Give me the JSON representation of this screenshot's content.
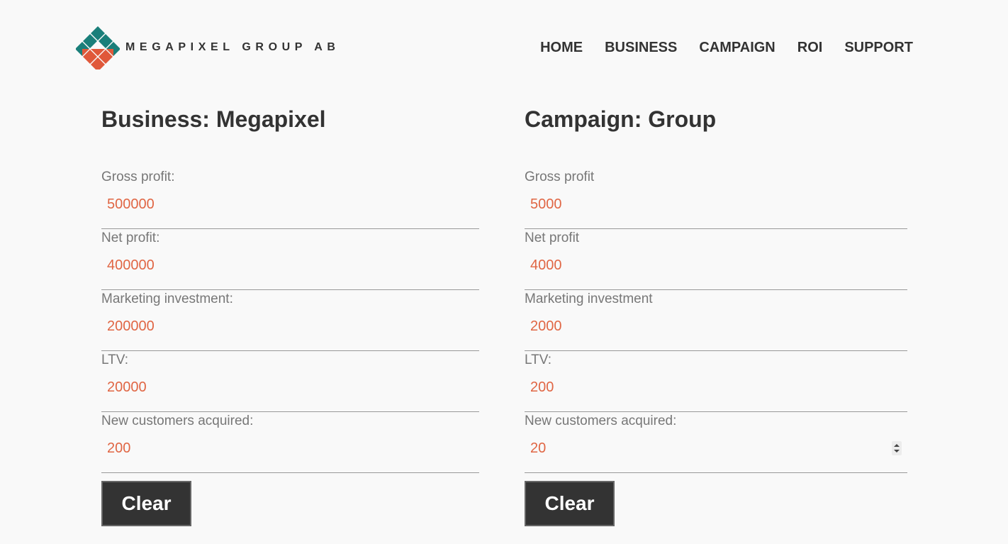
{
  "brand": {
    "name": "MEGAPIXEL GROUP AB",
    "colors": {
      "teal": "#1a7f7a",
      "orange": "#e0583a"
    }
  },
  "nav": {
    "items": [
      {
        "label": "HOME"
      },
      {
        "label": "BUSINESS"
      },
      {
        "label": "CAMPAIGN"
      },
      {
        "label": "ROI"
      },
      {
        "label": "SUPPORT"
      }
    ]
  },
  "business": {
    "title": "Business: Megapixel",
    "fields": [
      {
        "label": "Gross profit:",
        "value": "500000"
      },
      {
        "label": "Net profit:",
        "value": "400000"
      },
      {
        "label": "Marketing investment:",
        "value": "200000"
      },
      {
        "label": "LTV:",
        "value": "20000"
      },
      {
        "label": "New customers acquired:",
        "value": "200"
      }
    ],
    "clear_label": "Clear"
  },
  "campaign": {
    "title": "Campaign: Group",
    "fields": [
      {
        "label": "Gross profit",
        "value": "5000"
      },
      {
        "label": "Net profit",
        "value": "4000"
      },
      {
        "label": "Marketing investment",
        "value": "2000"
      },
      {
        "label": "LTV:",
        "value": "200"
      },
      {
        "label": "New customers acquired:",
        "value": "20"
      }
    ],
    "clear_label": "Clear"
  },
  "theme": {
    "value_color": "#e06644",
    "label_color": "#777777",
    "button_bg": "#333333"
  }
}
